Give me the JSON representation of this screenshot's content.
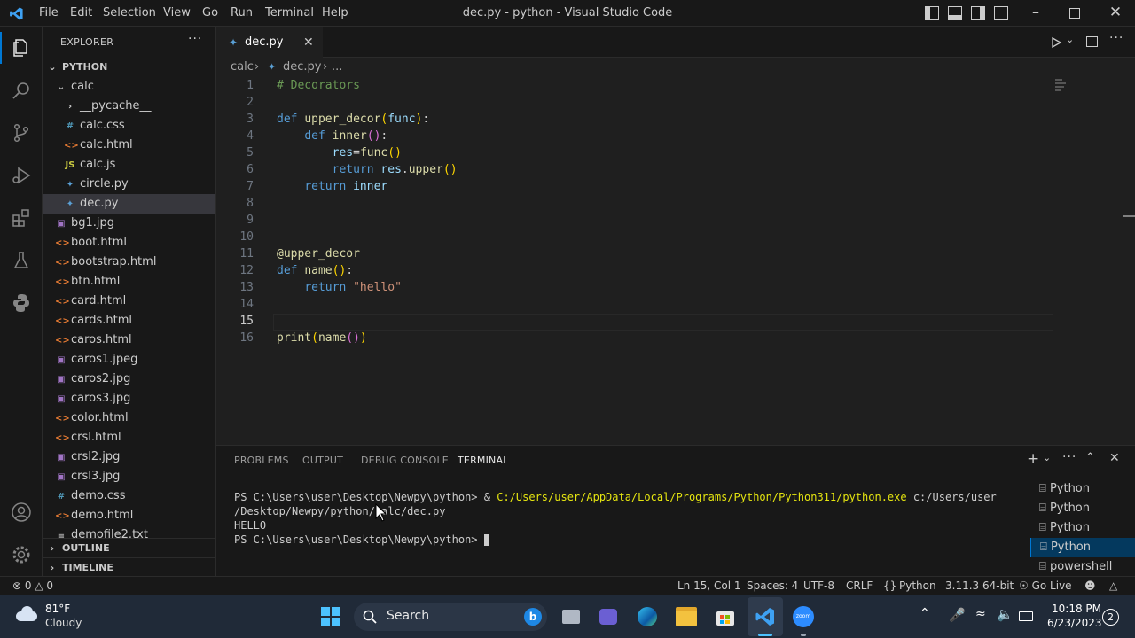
{
  "titlebar": {
    "menus": [
      "File",
      "Edit",
      "Selection",
      "View",
      "Go",
      "Run",
      "Terminal",
      "Help"
    ],
    "title": "dec.py - python - Visual Studio Code"
  },
  "sidebar": {
    "header": "EXPLORER",
    "root": "PYTHON",
    "folder": "calc",
    "calc_items": [
      {
        "name": "__pycache__",
        "icon": "chevron-right-icon"
      },
      {
        "name": "calc.css",
        "icon": "css-file-icon"
      },
      {
        "name": "calc.html",
        "icon": "html-file-icon"
      },
      {
        "name": "calc.js",
        "icon": "js-file-icon"
      },
      {
        "name": "circle.py",
        "icon": "python-file-icon"
      },
      {
        "name": "dec.py",
        "icon": "python-file-icon"
      }
    ],
    "root_items": [
      {
        "name": "bg1.jpg",
        "icon": "image-file-icon"
      },
      {
        "name": "boot.html",
        "icon": "html-file-icon"
      },
      {
        "name": "bootstrap.html",
        "icon": "html-file-icon"
      },
      {
        "name": "btn.html",
        "icon": "html-file-icon"
      },
      {
        "name": "card.html",
        "icon": "html-file-icon"
      },
      {
        "name": "cards.html",
        "icon": "html-file-icon"
      },
      {
        "name": "caros.html",
        "icon": "html-file-icon"
      },
      {
        "name": "caros1.jpeg",
        "icon": "image-file-icon"
      },
      {
        "name": "caros2.jpg",
        "icon": "image-file-icon"
      },
      {
        "name": "caros3.jpg",
        "icon": "image-file-icon"
      },
      {
        "name": "color.html",
        "icon": "html-file-icon"
      },
      {
        "name": "crsl.html",
        "icon": "html-file-icon"
      },
      {
        "name": "crsl2.jpg",
        "icon": "image-file-icon"
      },
      {
        "name": "crsl3.jpg",
        "icon": "image-file-icon"
      },
      {
        "name": "demo.css",
        "icon": "css-file-icon"
      },
      {
        "name": "demo.html",
        "icon": "html-file-icon"
      },
      {
        "name": "demofile2.txt",
        "icon": "text-file-icon"
      }
    ],
    "outline": "OUTLINE",
    "timeline": "TIMELINE"
  },
  "tab": {
    "label": "dec.py"
  },
  "breadcrumb": {
    "folder": "calc",
    "file": "dec.py",
    "more": "..."
  },
  "editor": {
    "lines": [
      [
        [
          "cm",
          "# Decorators"
        ]
      ],
      [],
      [
        [
          "kw",
          "def "
        ],
        [
          "fn",
          "upper_decor"
        ],
        [
          "br1",
          "("
        ],
        [
          "pm",
          "func"
        ],
        [
          "br1",
          ")"
        ],
        [
          "pl",
          ":"
        ]
      ],
      [
        [
          "pl",
          "    "
        ],
        [
          "kw",
          "def "
        ],
        [
          "fn",
          "inner"
        ],
        [
          "br2",
          "()"
        ],
        [
          "pl",
          ":"
        ]
      ],
      [
        [
          "pl",
          "        "
        ],
        [
          "pm",
          "res"
        ],
        [
          "pl",
          "="
        ],
        [
          "fn",
          "func"
        ],
        [
          "br1",
          "()"
        ]
      ],
      [
        [
          "pl",
          "        "
        ],
        [
          "kw",
          "return "
        ],
        [
          "pm",
          "res"
        ],
        [
          "pl",
          "."
        ],
        [
          "fn",
          "upper"
        ],
        [
          "br1",
          "()"
        ]
      ],
      [
        [
          "pl",
          "    "
        ],
        [
          "kw",
          "return "
        ],
        [
          "pm",
          "inner"
        ]
      ],
      [],
      [],
      [],
      [
        [
          "dec",
          "@upper_decor"
        ]
      ],
      [
        [
          "kw",
          "def "
        ],
        [
          "fn",
          "name"
        ],
        [
          "br1",
          "()"
        ],
        [
          "pl",
          ":"
        ]
      ],
      [
        [
          "pl",
          "    "
        ],
        [
          "kw",
          "return "
        ],
        [
          "st",
          "\"hello\""
        ]
      ],
      [],
      [],
      [
        [
          "fn",
          "print"
        ],
        [
          "br1",
          "("
        ],
        [
          "fn",
          "name"
        ],
        [
          "br2",
          "()"
        ],
        [
          "br1",
          ")"
        ]
      ]
    ],
    "current_line": 15
  },
  "panel": {
    "tabs": [
      "PROBLEMS",
      "OUTPUT",
      "DEBUG CONSOLE",
      "TERMINAL"
    ],
    "active_tab": "TERMINAL",
    "terminal": {
      "line1_prompt": "PS C:\\Users\\user\\Desktop\\Newpy\\python> & ",
      "line1_cmd": "C:/Users/user/AppData/Local/Programs/Python/Python311/python.exe",
      "line1_arg": " c:/Users/user",
      "line2": "/Desktop/Newpy/python/calc/dec.py",
      "line3": "HELLO",
      "line4": "PS C:\\Users\\user\\Desktop\\Newpy\\python> "
    },
    "terminal_list": [
      "Python",
      "Python",
      "Python",
      "Python",
      "powershell"
    ]
  },
  "statusbar": {
    "errors": "0",
    "warnings": "0",
    "position": "Ln 15, Col 1",
    "spaces": "Spaces: 4",
    "encoding": "UTF-8",
    "eol": "CRLF",
    "language": "Python",
    "interpreter": "3.11.3 64-bit",
    "golive": "Go Live"
  },
  "taskbar": {
    "weather_temp": "81°F",
    "weather_desc": "Cloudy",
    "search": "Search",
    "time": "10:18 PM",
    "date": "6/23/2023",
    "notifications": "2"
  },
  "colors": {
    "accent": "#0078d4",
    "keyword": "#569cd6",
    "function": "#dcdcaa",
    "param": "#9cdcfe",
    "comment": "#6a9955",
    "string": "#ce9178"
  }
}
